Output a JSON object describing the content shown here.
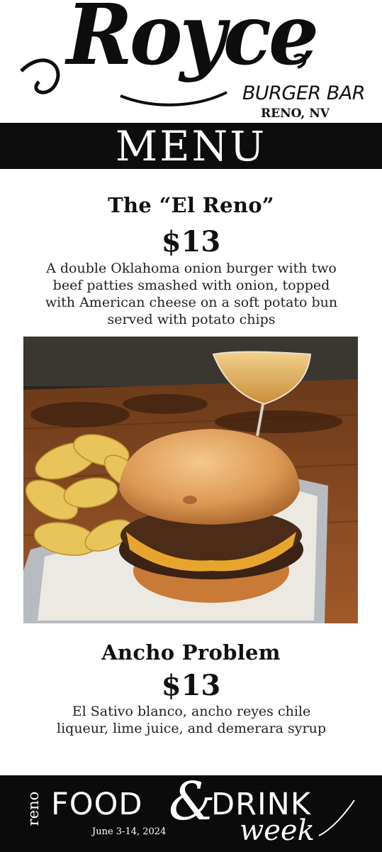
{
  "header": {
    "logo_text": "Royce",
    "subtitle": "BURGER BAR",
    "location": "RENO, NV"
  },
  "menu_banner": "MENU",
  "items": [
    {
      "title": "The “El Reno”",
      "price": "$13",
      "description_lines": [
        "A double Oklahoma onion burger with two",
        "beef patties smashed with onion, topped",
        "with American cheese on a soft potato bun",
        "served with potato chips"
      ]
    },
    {
      "title": "Ancho Problem",
      "price": "$13",
      "description_lines": [
        "El Sativo blanco, ancho reyes chile",
        "liqueur, lime juice, and demerara syrup"
      ]
    }
  ],
  "footer": {
    "reno": "reno",
    "food": "FOOD",
    "amp": "&",
    "drink": "DRINK",
    "week": "week",
    "dates": "June 3-14, 2024"
  },
  "colors": {
    "black": "#0d0d0d",
    "white": "#ffffff"
  }
}
